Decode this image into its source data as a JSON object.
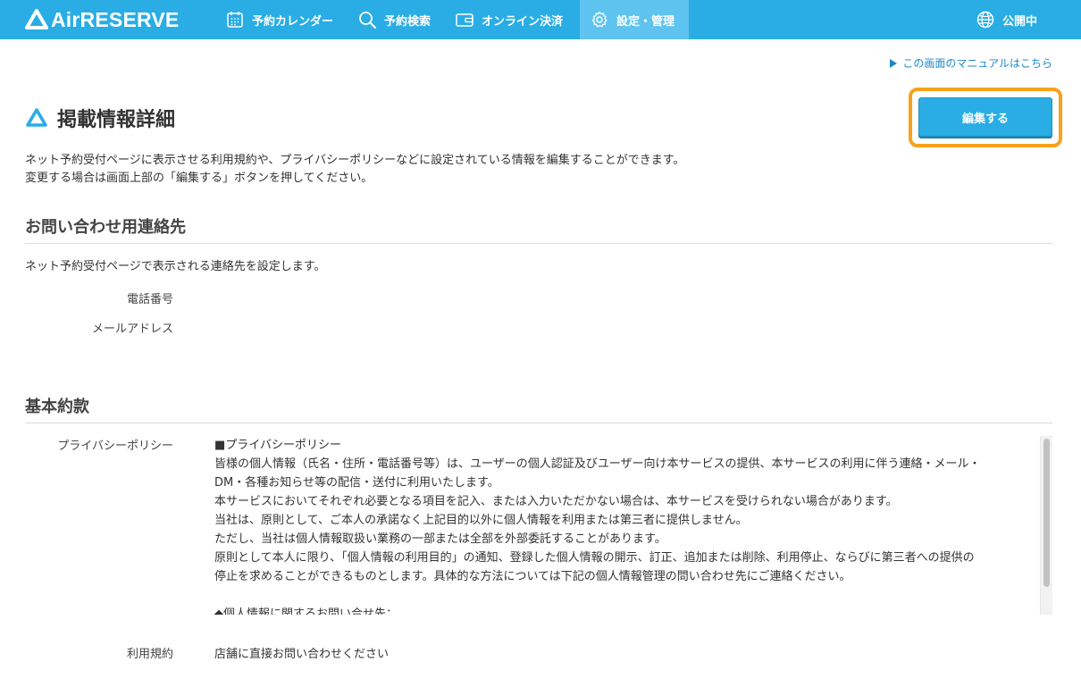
{
  "header": {
    "logo_text": "AirRESERVE",
    "nav": {
      "calendar": "予約カレンダー",
      "search": "予約検索",
      "payment": "オンライン決済",
      "settings": "設定・管理",
      "public_status": "公開中"
    }
  },
  "colors": {
    "brand": "#29ade4",
    "nav_active": "#5ec3ee",
    "highlight": "#f7a21b",
    "link": "#1e88c8"
  },
  "icons": {
    "logo": "triangle-logo-icon",
    "calendar": "calendar-icon",
    "search": "search-icon",
    "payment": "wallet-icon",
    "settings": "gear-icon",
    "public": "globe-icon",
    "title": "triangle-logo-icon"
  },
  "page": {
    "manual_link": "この画面のマニュアルはこちら",
    "title": "掲載情報詳細",
    "edit_button": "編集する",
    "description": [
      "ネット予約受付ページに表示させる利用規約や、プライバシーポリシーなどに設定されている情報を編集することができます。",
      "変更する場合は画面上部の「編集する」ボタンを押してください。"
    ]
  },
  "contact": {
    "heading": "お問い合わせ用連絡先",
    "description": "ネット予約受付ページで表示される連絡先を設定します。",
    "phone_label": "電話番号",
    "phone_value": "",
    "email_label": "メールアドレス",
    "email_value": ""
  },
  "terms": {
    "heading": "基本約款",
    "privacy_label": "プライバシーポリシー",
    "privacy_lines": [
      "■プライバシーポリシー",
      "皆様の個人情報（氏名・住所・電話番号等）は、ユーザーの個人認証及びユーザー向け本サービスの提供、本サービスの利用に伴う連絡・メール・",
      "DM・各種お知らせ等の配信・送付に利用いたします。",
      "本サービスにおいてそれぞれ必要となる項目を記入、または入力いただかない場合は、本サービスを受けられない場合があります。",
      "当社は、原則として、ご本人の承諾なく上記目的以外に個人情報を利用または第三者に提供しません。",
      "ただし、当社は個人情報取扱い業務の一部または全部を外部委託することがあります。",
      "原則として本人に限り、「個人情報の利用目的」の通知、登録した個人情報の開示、訂正、追加または削除、利用停止、ならびに第三者への提供の",
      "停止を求めることができるものとします。具体的な方法については下記の個人情報管理の問い合わせ先にご連絡ください。",
      "",
      "◆個人情報に関するお問い合せ先："
    ],
    "terms_label": "利用規約",
    "terms_value": "店舗に直接お問い合わせください"
  }
}
